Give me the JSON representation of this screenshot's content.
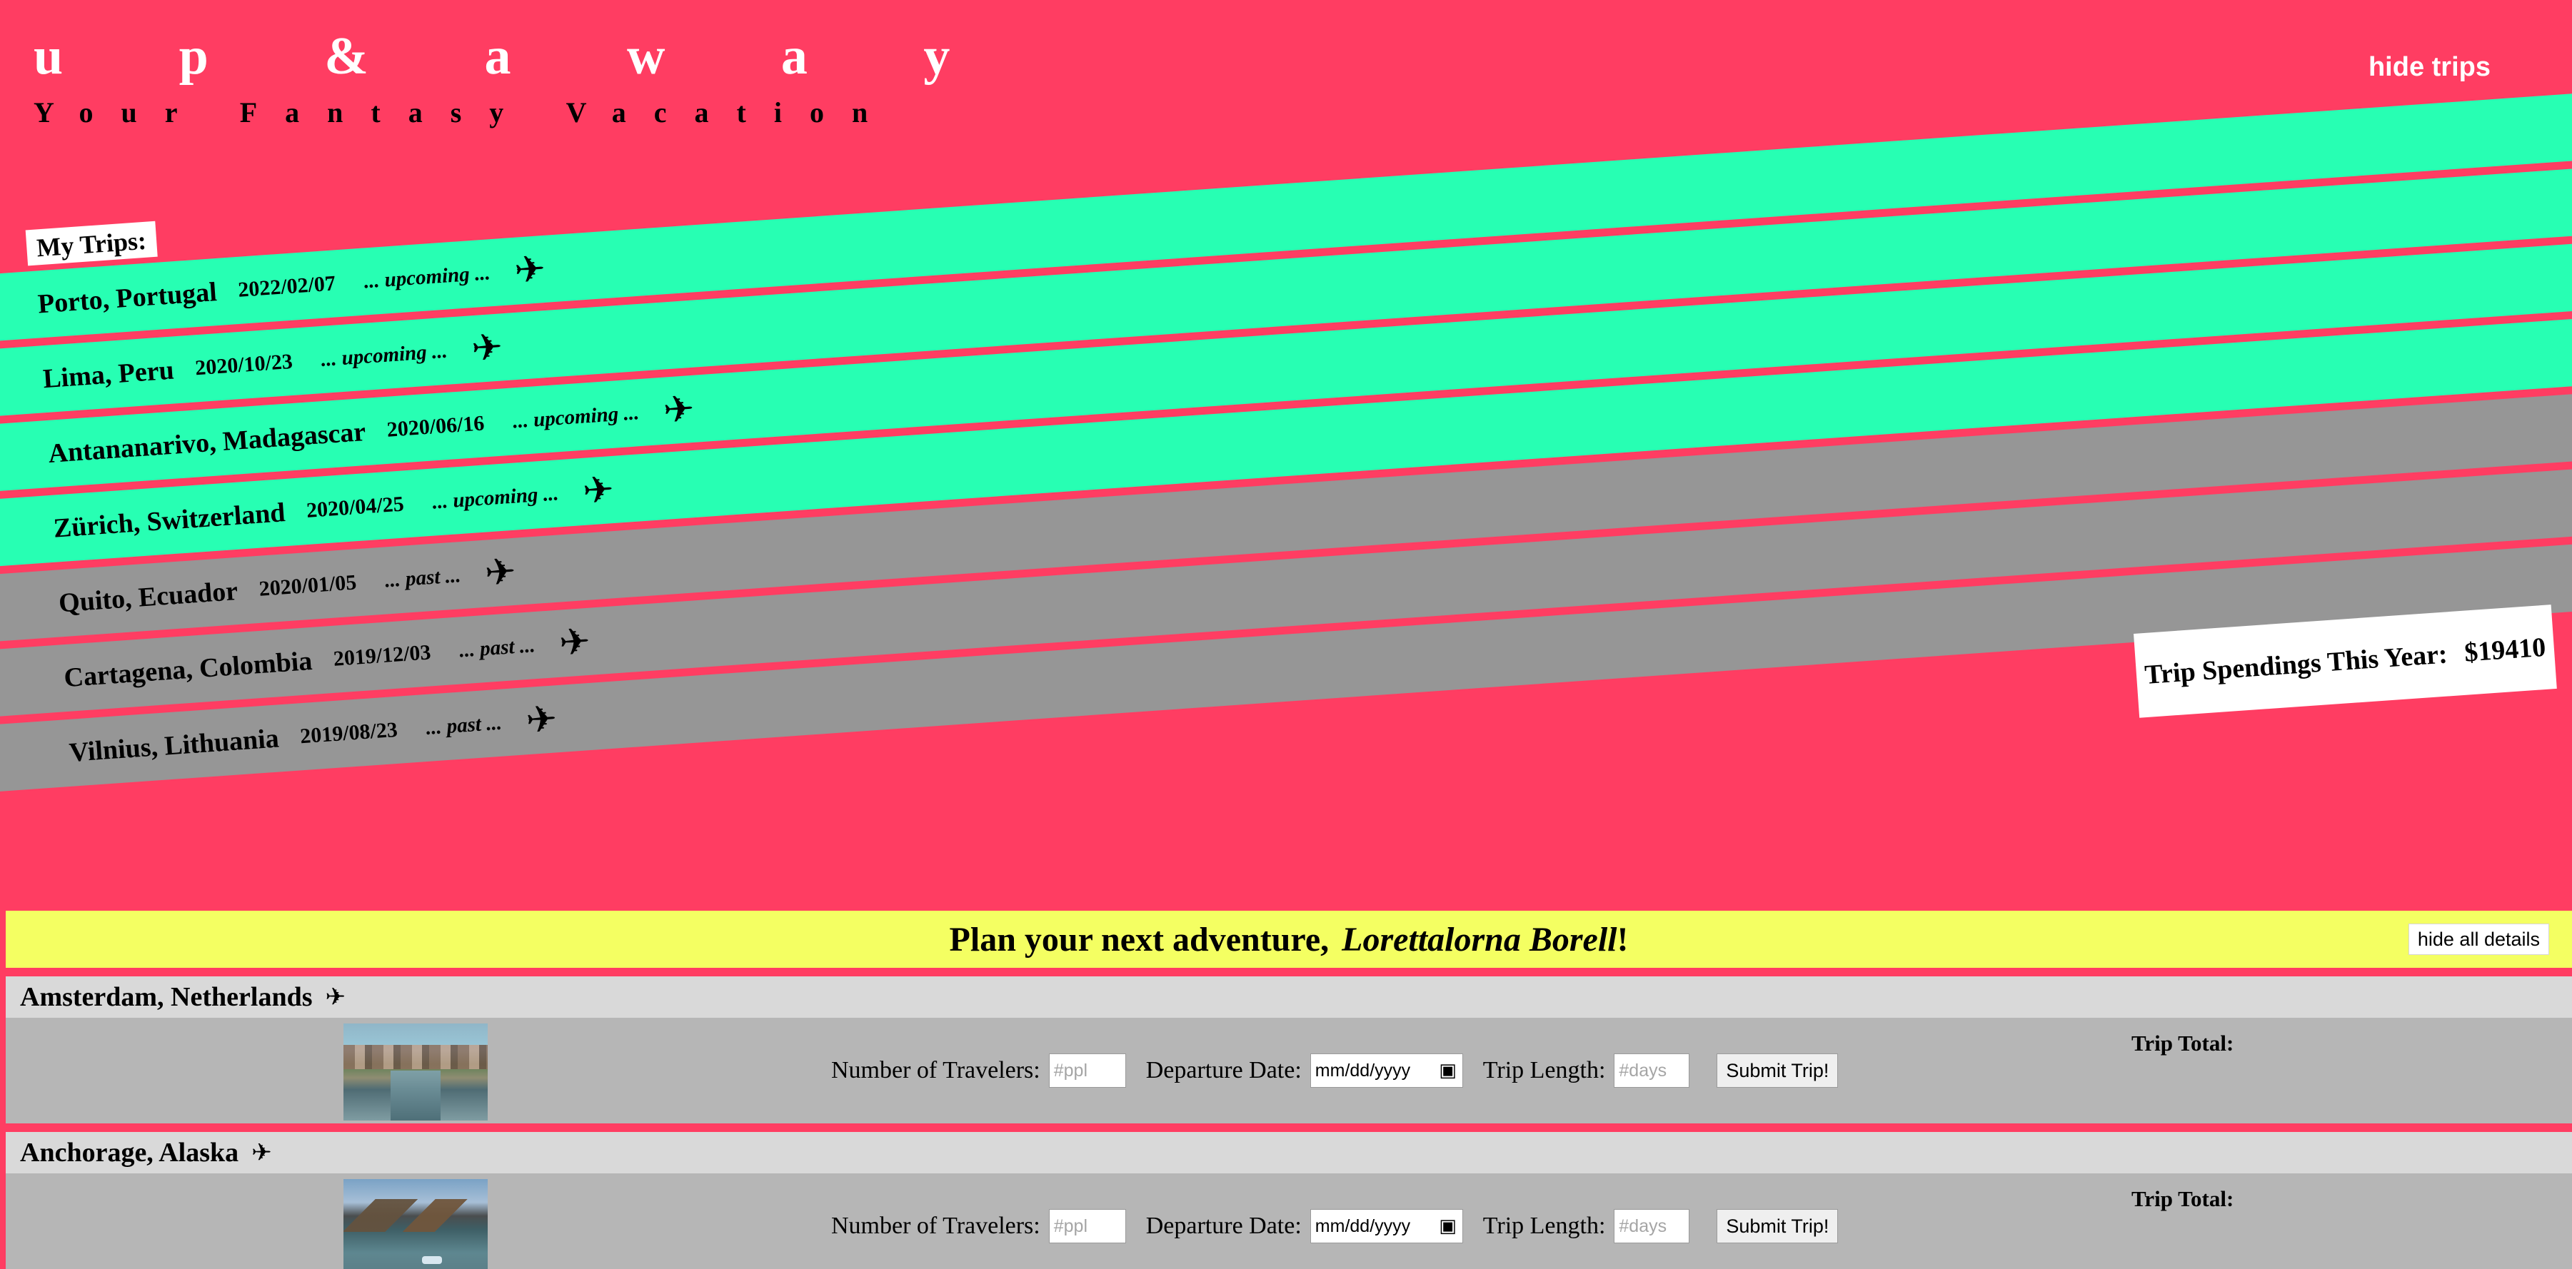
{
  "header": {
    "title": "u p & a w a y",
    "subtitle": "Your Fantasy Vacation",
    "hide_trips": "hide trips"
  },
  "trips": {
    "label": "My Trips:",
    "items": [
      {
        "destination": "Porto, Portugal",
        "date": "2022/02/07",
        "status": "... upcoming ...",
        "state": "upcoming"
      },
      {
        "destination": "Lima, Peru",
        "date": "2020/10/23",
        "status": "... upcoming ...",
        "state": "upcoming"
      },
      {
        "destination": "Antananarivo, Madagascar",
        "date": "2020/06/16",
        "status": "... upcoming ...",
        "state": "upcoming"
      },
      {
        "destination": "Zürich, Switzerland",
        "date": "2020/04/25",
        "status": "... upcoming ...",
        "state": "upcoming"
      },
      {
        "destination": "Quito, Ecuador",
        "date": "2020/01/05",
        "status": "... past ...",
        "state": "past"
      },
      {
        "destination": "Cartagena, Colombia",
        "date": "2019/12/03",
        "status": "... past ...",
        "state": "past"
      },
      {
        "destination": "Vilnius, Lithuania",
        "date": "2019/08/23",
        "status": "... past ...",
        "state": "past"
      }
    ]
  },
  "spendings": {
    "label": "Trip Spendings This Year:",
    "value": "$19410"
  },
  "planner": {
    "greeting": "Plan your next adventure,",
    "user_name": "Lorettalorna Borell",
    "exclamation": "!",
    "hide_all_details": "hide all details"
  },
  "destinations": [
    {
      "name": "Amsterdam, Netherlands",
      "travelers_label": "Number of Travelers:",
      "travelers_placeholder": "#ppl",
      "departure_label": "Departure Date:",
      "departure_value": "mm/dd/yyyy",
      "length_label": "Trip Length:",
      "length_placeholder": "#days",
      "submit": "Submit Trip!",
      "total_label": "Trip Total:"
    },
    {
      "name": "Anchorage, Alaska",
      "travelers_label": "Number of Travelers:",
      "travelers_placeholder": "#ppl",
      "departure_label": "Departure Date:",
      "departure_value": "mm/dd/yyyy",
      "length_label": "Trip Length:",
      "length_placeholder": "#days",
      "submit": "Submit Trip!",
      "total_label": "Trip Total:"
    }
  ],
  "icons": {
    "plane": "airplane-icon",
    "calendar": "calendar-icon"
  },
  "colors": {
    "background": "#ff3d62",
    "upcoming_trip": "#27ffb3",
    "past_trip": "#969696",
    "planner_header": "#f4ff62"
  }
}
